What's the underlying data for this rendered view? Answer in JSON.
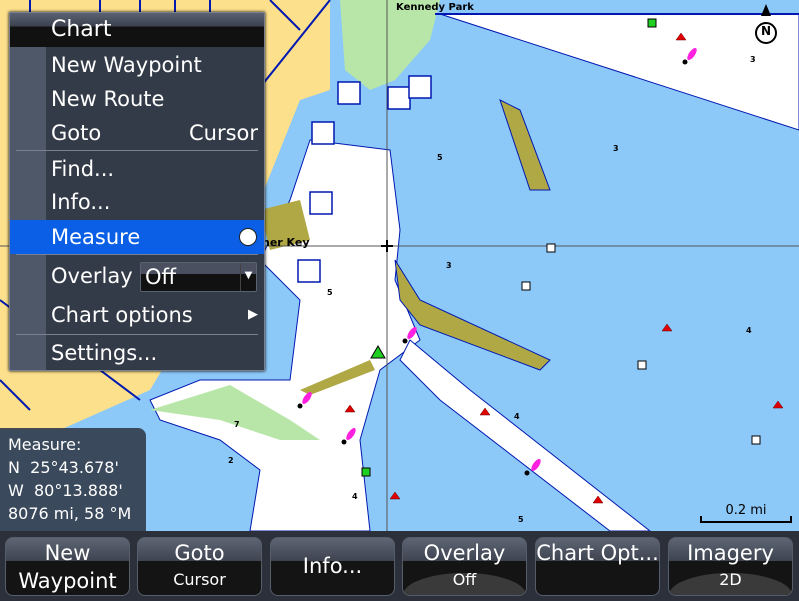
{
  "map": {
    "place_labels": [
      "Kennedy Park",
      "ner Key"
    ],
    "depths": [
      "3",
      "5",
      "3",
      "3",
      "4",
      "4",
      "5",
      "2",
      "4",
      "5",
      "7"
    ],
    "north_label": "N",
    "scale_label": "0.2 mi",
    "colors": {
      "water": "#8cc8f8",
      "land": "#fde08c",
      "shallow": "#ffffff",
      "vegetation": "#b8e6a8",
      "mud": "#b0a844",
      "highlight": "#0a5fe6"
    }
  },
  "menu": {
    "title": "Chart",
    "items": [
      {
        "label": "New Waypoint"
      },
      {
        "label": "New Route"
      },
      {
        "label": "Goto",
        "value": "Cursor"
      },
      {
        "label": "Find..."
      },
      {
        "label": "Info..."
      },
      {
        "label": "Measure",
        "selected": true
      },
      {
        "label": "Overlay",
        "value": "Off"
      },
      {
        "label": "Chart options"
      },
      {
        "label": "Settings..."
      }
    ]
  },
  "measure": {
    "title": "Measure:",
    "lat": "N  25°43.678'",
    "lon": "W  80°13.888'",
    "dist": "8076 mi, 58 °M"
  },
  "softkeys": [
    {
      "line1": "New",
      "line2": "Waypoint"
    },
    {
      "line1": "Goto",
      "line2": "Cursor"
    },
    {
      "line1": "Info..."
    },
    {
      "line1": "Overlay",
      "line2": "Off"
    },
    {
      "line1": "Chart Opt..."
    },
    {
      "line1": "Imagery",
      "line2": "2D"
    }
  ]
}
